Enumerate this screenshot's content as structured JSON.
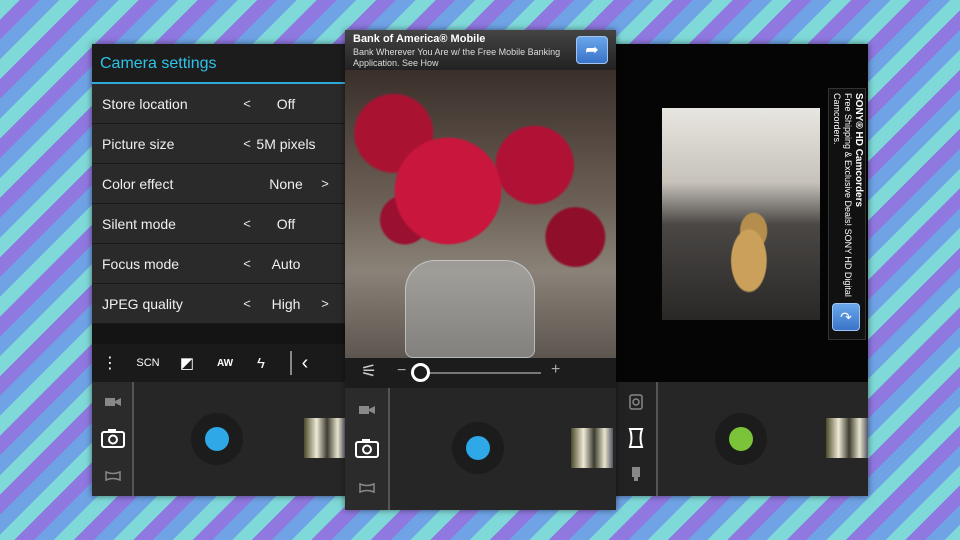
{
  "left_phone": {
    "title": "Camera settings",
    "settings": [
      {
        "label": "Store location",
        "left": "<",
        "value": "Off",
        "right": ""
      },
      {
        "label": "Picture size",
        "left": "<",
        "value": "5M pixels",
        "right": ""
      },
      {
        "label": "Color effect",
        "left": "",
        "value": "None",
        "right": ">"
      },
      {
        "label": "Silent mode",
        "left": "<",
        "value": "Off",
        "right": ""
      },
      {
        "label": "Focus mode",
        "left": "<",
        "value": "Auto",
        "right": ""
      },
      {
        "label": "JPEG quality",
        "left": "<",
        "value": "High",
        "right": ">"
      }
    ],
    "toolbar": {
      "menu_glyph": "⋮",
      "scene_label": "SCN",
      "exposure_glyph": "◩",
      "wb_label": "AW",
      "flash_glyph": "ϟ",
      "chevron_glyph": "‹"
    },
    "shutter_color": "#2ea8e6"
  },
  "center_phone": {
    "ad": {
      "title": "Bank of America® Mobile",
      "text": "Bank Wherever You Are w/ the Free Mobile Banking Application. See How",
      "button_glyph": "➦"
    },
    "zoom": {
      "minus": "−",
      "plus": "+",
      "level": 0.0,
      "settings_glyph": "⚟"
    },
    "shutter_color": "#2ea8e6"
  },
  "right_phone": {
    "side_ad": {
      "title": "SONY® HD Camcorders",
      "text": "Free Shipping & Exclusive Deals! SONY HD Digital Camcorders.",
      "button_glyph": "↷"
    },
    "shutter_color": "#7bc43a"
  },
  "colors": {
    "accent": "#2fc3e8",
    "background_stripe_1": "#7fd9d8",
    "background_stripe_2": "#8f78e0",
    "background_stripe_3": "#6fa3e6"
  }
}
